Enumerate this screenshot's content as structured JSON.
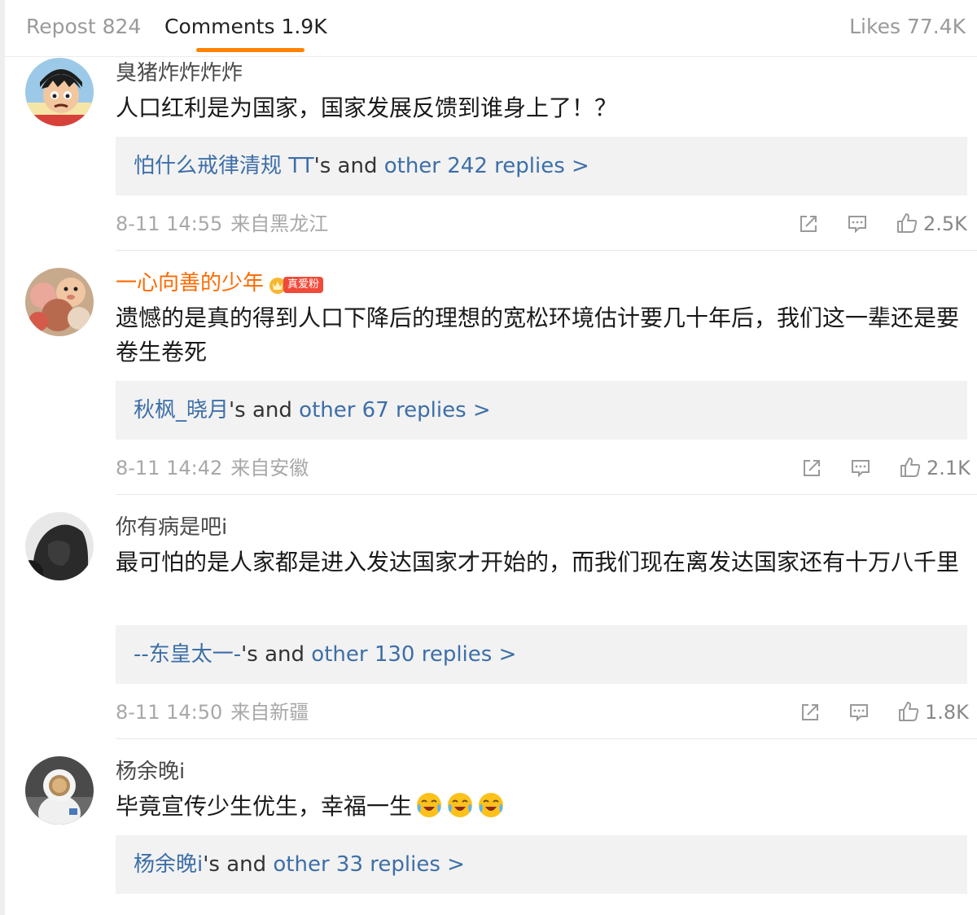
{
  "tabs": {
    "repost": "Repost 824",
    "comments": "Comments 1.9K",
    "likes": "Likes 77.4K"
  },
  "accent_color": "#ff8200",
  "link_color": "#3d6fa8",
  "comments": [
    {
      "username": "臭猪炸炸炸炸",
      "text": "人口红利是为国家，国家发展反馈到谁身上了！？",
      "reply_user": "怕什么戒律清规 TT",
      "reply_mid": "'s and ",
      "reply_more": "other 242 replies >",
      "time": "8-11 14:55",
      "location": "来自黑龙江",
      "likes": "2.5K"
    },
    {
      "username": "一心向善的少年",
      "badge": "真爱粉",
      "text": "遗憾的是真的得到人口下降后的理想的宽松环境估计要几十年后，我们这一辈还是要卷生卷死",
      "reply_user": "秋枫_晓月",
      "reply_mid": "'s and ",
      "reply_more": "other 67 replies >",
      "time": "8-11 14:42",
      "location": "来自安徽",
      "likes": "2.1K"
    },
    {
      "username": "你有病是吧i",
      "text": "最可怕的是人家都是进入发达国家才开始的，而我们现在离发达国家还有十万八千里",
      "reply_user": "--东皇太一-",
      "reply_mid": "'s and ",
      "reply_more": "other 130 replies >",
      "time": "8-11 14:50",
      "location": "来自新疆",
      "likes": "1.8K"
    },
    {
      "username": "杨余晚i",
      "text": "毕竟宣传少生优生，幸福一生",
      "reply_user": "杨余晚i",
      "reply_mid": "'s and ",
      "reply_more": "other 33 replies >",
      "emoji": "crying-laughing-face"
    }
  ]
}
